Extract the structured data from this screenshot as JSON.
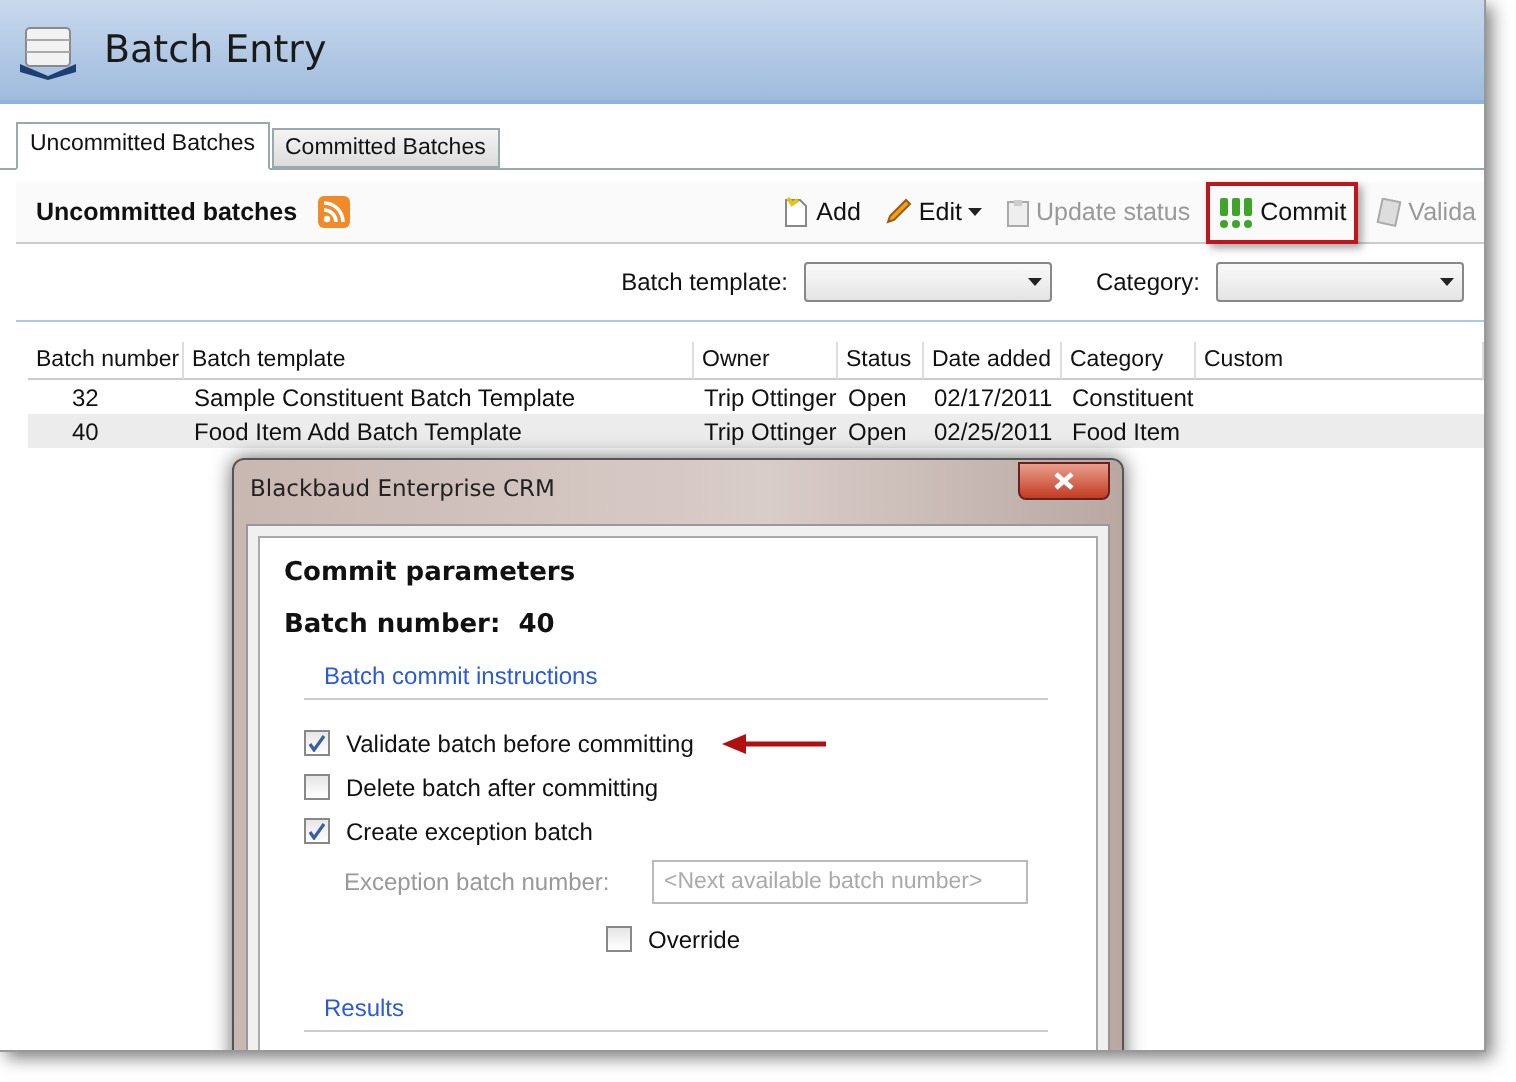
{
  "window": {
    "title": "Batch Entry"
  },
  "tabs": [
    {
      "label": "Uncommitted Batches",
      "selected": true
    },
    {
      "label": "Committed Batches",
      "selected": false
    }
  ],
  "section": {
    "title": "Uncommitted batches"
  },
  "toolbar": [
    {
      "kind": "add",
      "label": "Add",
      "disabled": false,
      "highlighted": false,
      "dropdown": false
    },
    {
      "kind": "edit",
      "label": "Edit",
      "disabled": false,
      "highlighted": false,
      "dropdown": true
    },
    {
      "kind": "status",
      "label": "Update status",
      "disabled": true,
      "highlighted": false,
      "dropdown": false
    },
    {
      "kind": "commit",
      "label": "Commit",
      "disabled": false,
      "highlighted": true,
      "dropdown": false
    },
    {
      "kind": "validate",
      "label": "Valida",
      "disabled": true,
      "highlighted": false,
      "dropdown": false
    }
  ],
  "filters": [
    {
      "label": "Batch template:"
    },
    {
      "label": "Category:"
    }
  ],
  "table": {
    "columns": [
      "Batch number",
      "Batch template",
      "Owner",
      "Status",
      "Date added",
      "Category",
      "Custom"
    ],
    "rows": [
      {
        "selected": false,
        "cells": [
          "32",
          "Sample Constituent Batch Template",
          "Trip Ottinger",
          "Open",
          "02/17/2011",
          "Constituent"
        ]
      },
      {
        "selected": true,
        "cells": [
          "40",
          "Food Item Add Batch Template",
          "Trip Ottinger",
          "Open",
          "02/25/2011",
          "Food Item"
        ]
      }
    ]
  },
  "dialog": {
    "title": "Blackbaud Enterprise CRM",
    "heading": "Commit parameters",
    "batch_label": "Batch number:",
    "batch_value": "40",
    "instructions_title": "Batch commit instructions",
    "options": [
      {
        "label": "Validate batch before committing",
        "checked": true
      },
      {
        "label": "Delete batch after committing",
        "checked": false
      },
      {
        "label": "Create exception batch",
        "checked": true
      }
    ],
    "exception_field": {
      "label": "Exception batch number:",
      "placeholder": "<Next available batch number>",
      "disabled": true
    },
    "override": {
      "label": "Override",
      "checked": false
    },
    "results_title": "Results"
  }
}
